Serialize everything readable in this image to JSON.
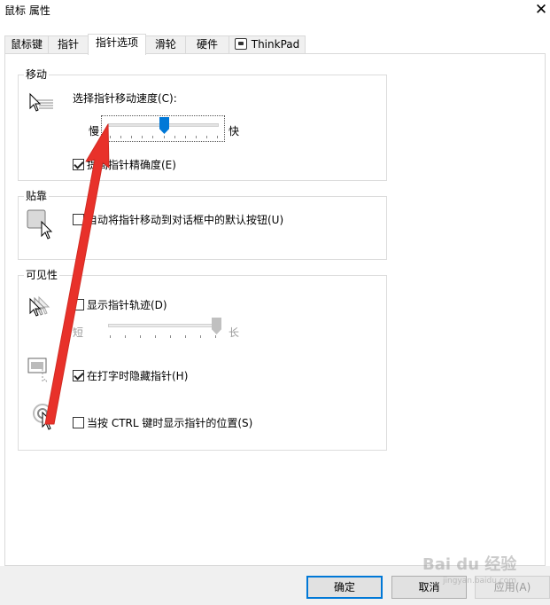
{
  "window": {
    "title": "鼠标 属性",
    "close_glyph": "✕"
  },
  "tabs": [
    {
      "label": "鼠标键"
    },
    {
      "label": "指针"
    },
    {
      "label": "指针选项"
    },
    {
      "label": "滑轮"
    },
    {
      "label": "硬件"
    },
    {
      "label": "ThinkPad"
    }
  ],
  "active_tab": "指针选项",
  "motion": {
    "group_label": "移动",
    "speed_label": "选择指针移动速度(C):",
    "slow_label": "慢",
    "fast_label": "快",
    "speed_level": 0.5,
    "precision_label": "提高指针精确度(E)",
    "precision_checked": true
  },
  "snap": {
    "group_label": "贴靠",
    "snap_label": "自动将指针移动到对话框中的默认按钮(U)",
    "snap_checked": false
  },
  "visibility": {
    "group_label": "可见性",
    "trails_label": "显示指针轨迹(D)",
    "trails_checked": false,
    "short_label": "短",
    "long_label": "长",
    "trail_length_level": 1.0,
    "hide_typing_label": "在打字时隐藏指针(H)",
    "hide_typing_checked": true,
    "ctrl_label": "当按 CTRL 键时显示指针的位置(S)",
    "ctrl_checked": false
  },
  "buttons": {
    "ok": "确定",
    "cancel": "取消",
    "apply": "应用(A)"
  },
  "watermark": {
    "text": "Bai du 经验",
    "sub": "jingyan.baidu.com"
  },
  "colors": {
    "accent": "#0078d7",
    "annotation_arrow": "#e8312a"
  }
}
